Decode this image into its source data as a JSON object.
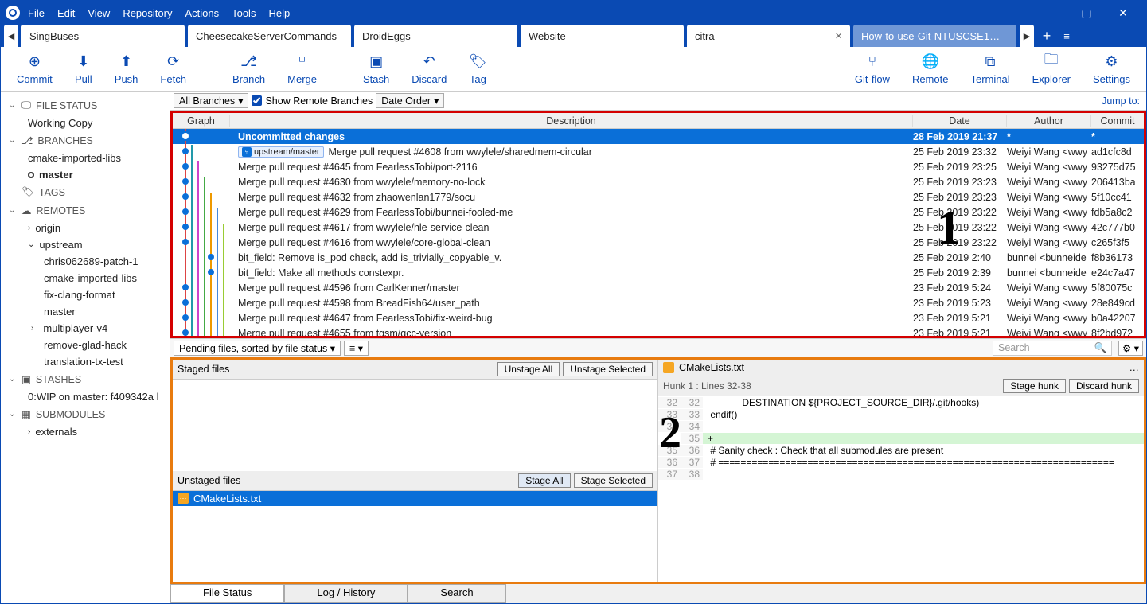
{
  "menu": {
    "items": [
      "File",
      "Edit",
      "View",
      "Repository",
      "Actions",
      "Tools",
      "Help"
    ]
  },
  "window": {
    "min": "—",
    "max": "▢",
    "close": "✕"
  },
  "tabs": {
    "items": [
      "SingBuses",
      "CheesecakeServerCommands",
      "DroidEggs",
      "Website",
      "citra",
      "How-to-use-Git-NTUSCSE1…"
    ],
    "active_index": 4,
    "close": "×",
    "plus": "+",
    "left": "◀",
    "right": "▶",
    "menu": "≡"
  },
  "toolbar": {
    "commit": "Commit",
    "pull": "Pull",
    "push": "Push",
    "fetch": "Fetch",
    "branch": "Branch",
    "merge": "Merge",
    "stash": "Stash",
    "discard": "Discard",
    "tag": "Tag",
    "gitflow": "Git-flow",
    "remote": "Remote",
    "terminal": "Terminal",
    "explorer": "Explorer",
    "settings": "Settings"
  },
  "sidebar": {
    "filestatus": {
      "header": "FILE STATUS",
      "items": [
        "Working Copy"
      ]
    },
    "branches": {
      "header": "BRANCHES",
      "items": [
        "cmake-imported-libs",
        "master"
      ],
      "current": "master"
    },
    "tags": {
      "header": "TAGS"
    },
    "remotes": {
      "header": "REMOTES",
      "items": [
        {
          "name": "origin",
          "children": []
        },
        {
          "name": "upstream",
          "children": [
            "chris062689-patch-1",
            "cmake-imported-libs",
            "fix-clang-format",
            "master",
            "multiplayer-v4",
            "remove-glad-hack",
            "translation-tx-test"
          ]
        }
      ]
    },
    "stashes": {
      "header": "STASHES",
      "items": [
        "0:WIP on master: f409342a l"
      ]
    },
    "submodules": {
      "header": "SUBMODULES",
      "items": [
        "externals"
      ]
    }
  },
  "filter": {
    "branches": "All Branches",
    "chev": "▾",
    "remote_check": true,
    "remote_label": "Show Remote Branches",
    "order": "Date Order",
    "jump": "Jump to:"
  },
  "commit_header": {
    "graph": "Graph",
    "desc": "Description",
    "date": "Date",
    "author": "Author",
    "commit": "Commit"
  },
  "commits": [
    {
      "desc": "Uncommitted changes",
      "date": "28 Feb 2019 21:37",
      "author": "*",
      "commit": "*",
      "selected": true
    },
    {
      "branch": "upstream/master",
      "desc": "Merge pull request #4608 from wwylele/sharedmem-circular",
      "date": "25 Feb 2019 23:32",
      "author": "Weiyi Wang <wwy",
      "commit": "ad1cfc8d"
    },
    {
      "desc": "Merge pull request #4645 from FearlessTobi/port-2116",
      "date": "25 Feb 2019 23:25",
      "author": "Weiyi Wang <wwy",
      "commit": "93275d75"
    },
    {
      "desc": "Merge pull request #4630 from wwylele/memory-no-lock",
      "date": "25 Feb 2019 23:23",
      "author": "Weiyi Wang <wwy",
      "commit": "206413ba"
    },
    {
      "desc": "Merge pull request #4632 from zhaowenlan1779/socu",
      "date": "25 Feb 2019 23:23",
      "author": "Weiyi Wang <wwy",
      "commit": "5f10cc41"
    },
    {
      "desc": "Merge pull request #4629 from FearlessTobi/bunnei-fooled-me",
      "date": "25 Feb 2019 23:22",
      "author": "Weiyi Wang <wwy",
      "commit": "fdb5a8c2"
    },
    {
      "desc": "Merge pull request #4617 from wwylele/hle-service-clean",
      "date": "25 Feb 2019 23:22",
      "author": "Weiyi Wang <wwy",
      "commit": "42c777b0"
    },
    {
      "desc": "Merge pull request #4616 from wwylele/core-global-clean",
      "date": "25 Feb 2019 23:22",
      "author": "Weiyi Wang <wwy",
      "commit": "c265f3f5"
    },
    {
      "desc": "bit_field: Remove is_pod check, add is_trivially_copyable_v.",
      "date": "25 Feb 2019 2:40",
      "author": "bunnei <bunneide",
      "commit": "f8b36173"
    },
    {
      "desc": "bit_field: Make all methods constexpr.",
      "date": "25 Feb 2019 2:39",
      "author": "bunnei <bunneide",
      "commit": "e24c7a47"
    },
    {
      "desc": "Merge pull request #4596 from CarlKenner/master",
      "date": "23 Feb 2019 5:24",
      "author": "Weiyi Wang <wwy",
      "commit": "5f80075c"
    },
    {
      "desc": "Merge pull request #4598 from BreadFish64/user_path",
      "date": "23 Feb 2019 5:23",
      "author": "Weiyi Wang <wwy",
      "commit": "28e849cd"
    },
    {
      "desc": "Merge pull request #4647 from FearlessTobi/fix-weird-bug",
      "date": "23 Feb 2019 5:21",
      "author": "Weiyi Wang <wwy",
      "commit": "b0a42207"
    },
    {
      "desc": "Merge pull request #4655 from tgsm/gcc-version",
      "date": "23 Feb 2019 5:21",
      "author": "Weiyi Wang <wwy",
      "commit": "8f2bd972"
    }
  ],
  "annot": {
    "one": "1",
    "two": "2"
  },
  "pending": {
    "sort": "Pending files, sorted by file status",
    "chev": "▾",
    "view": "≡",
    "search_ph": "Search",
    "search_ic": "🔍",
    "gear": "⚙",
    "gear_chev": "▾"
  },
  "staged": {
    "label": "Staged files",
    "unstage_all": "Unstage All",
    "unstage_sel": "Unstage Selected"
  },
  "unstaged": {
    "label": "Unstaged files",
    "stage_all": "Stage All",
    "stage_sel": "Stage Selected",
    "files": [
      {
        "name": "CMakeLists.txt",
        "status": "M"
      }
    ]
  },
  "diff": {
    "file": "CMakeLists.txt",
    "more": "…",
    "hunk_label": "Hunk 1 : Lines 32-38",
    "stage_hunk": "Stage hunk",
    "discard_hunk": "Discard hunk",
    "lines": [
      {
        "oln": "32",
        "nln": "32",
        "code": "            DESTINATION ${PROJECT_SOURCE_DIR}/.git/hooks)"
      },
      {
        "oln": "33",
        "nln": "33",
        "code": "endif()"
      },
      {
        "oln": "34",
        "nln": "34",
        "code": ""
      },
      {
        "oln": "",
        "nln": "35",
        "code": "",
        "add": true
      },
      {
        "oln": "35",
        "nln": "36",
        "code": "# Sanity check : Check that all submodules are present"
      },
      {
        "oln": "36",
        "nln": "37",
        "code": "# ======================================================================="
      },
      {
        "oln": "37",
        "nln": "38",
        "code": ""
      }
    ]
  },
  "bottom": {
    "filestatus": "File Status",
    "loghistory": "Log / History",
    "search": "Search"
  }
}
